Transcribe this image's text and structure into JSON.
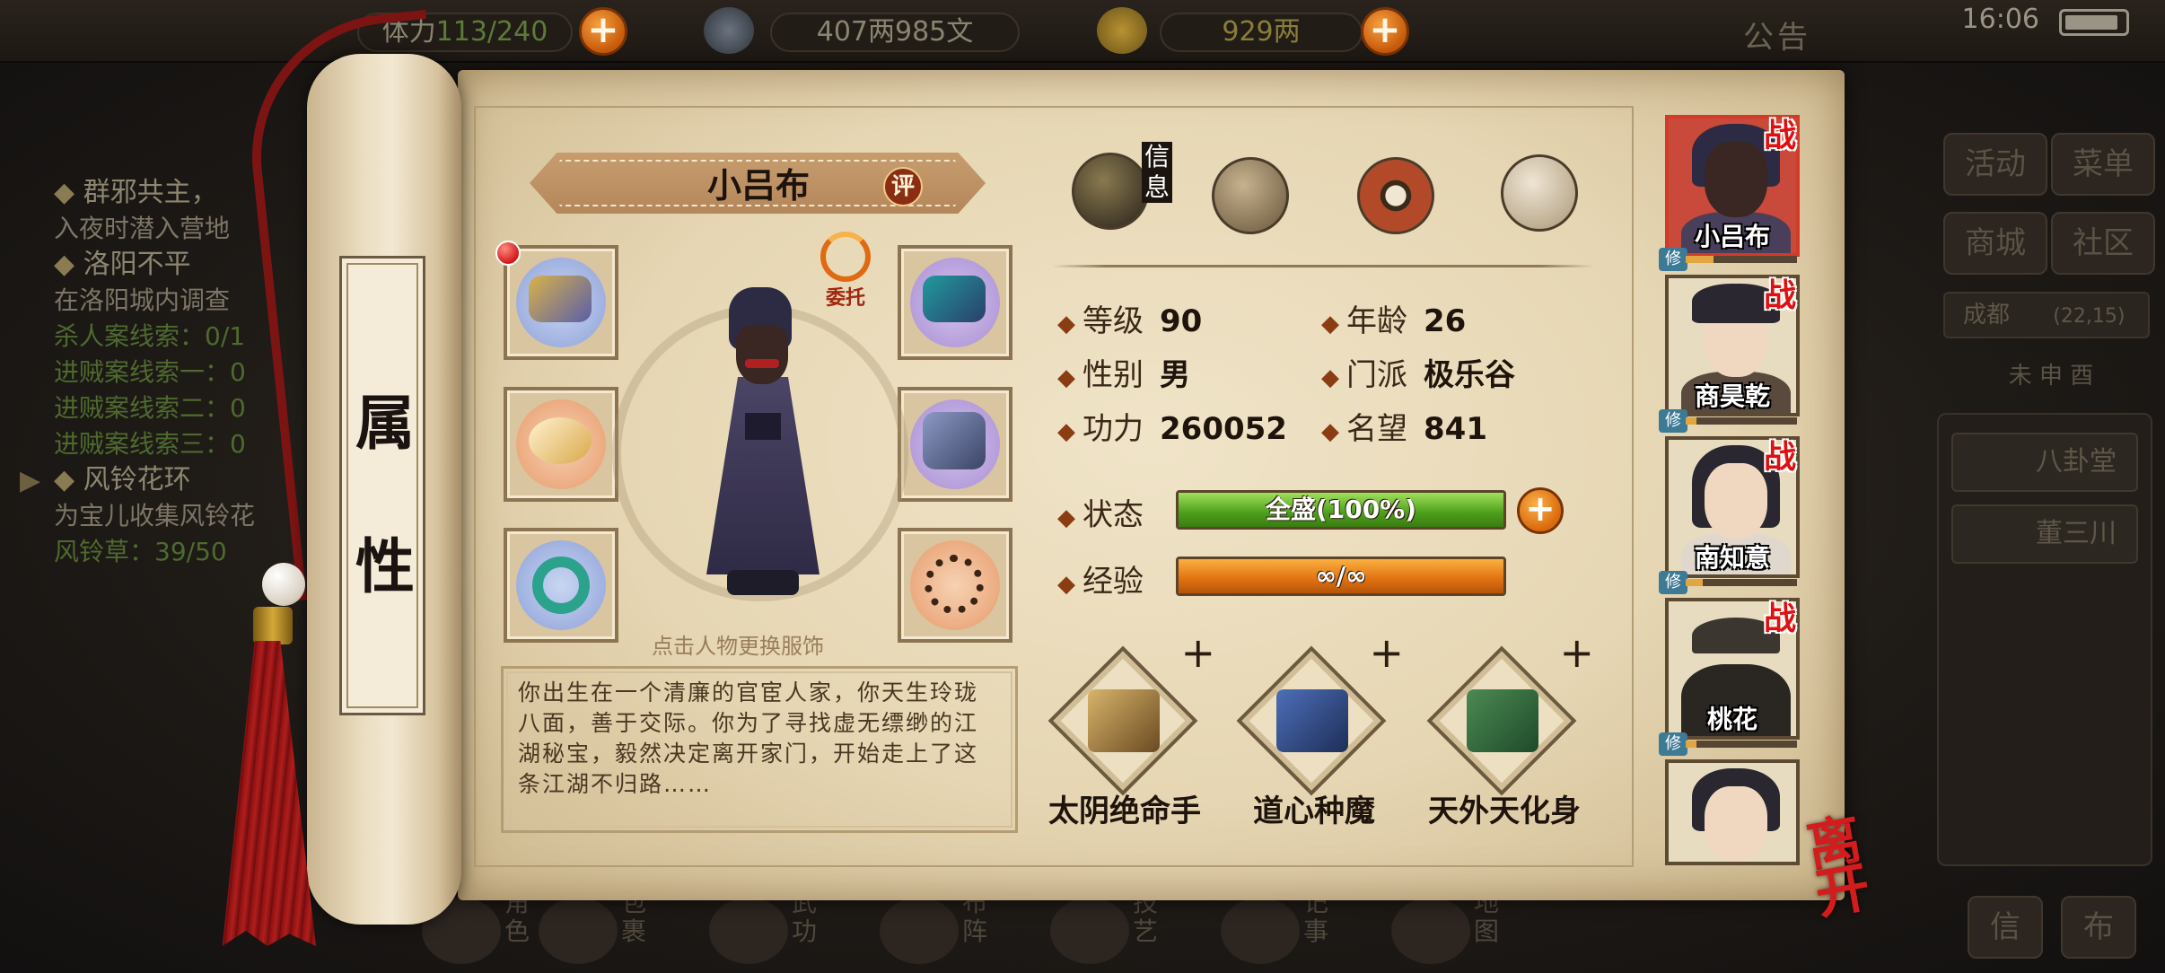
{
  "topbar": {
    "stamina": "113/240",
    "stamina_label": "体力",
    "coins": "407两985文",
    "ingots": "929两",
    "notice": "公告",
    "time": "16:06"
  },
  "quests": [
    {
      "title": "群邪共主，",
      "lines": [
        {
          "text": "入夜时潜入营地",
          "green": false
        }
      ]
    },
    {
      "title": "洛阳不平",
      "lines": [
        {
          "text": "在洛阳城内调查",
          "green": false
        },
        {
          "text": "杀人案线索：0/1",
          "green": true
        },
        {
          "text": "进贼案线索一：0",
          "green": true
        },
        {
          "text": "进贼案线索二：0",
          "green": true
        },
        {
          "text": "进贼案线索三：0",
          "green": true
        }
      ]
    },
    {
      "title": "风铃花环",
      "lines": [
        {
          "text": "为宝儿收集风铃花",
          "green": false
        },
        {
          "text": "风铃草：39/50",
          "green": true
        }
      ]
    }
  ],
  "right_menu": {
    "buttons": [
      "活动",
      "菜单",
      "商城",
      "社区"
    ],
    "city": "成都",
    "coords": "(22,15)",
    "time_marks": "未 申 酉",
    "npcs": [
      "八卦堂",
      "董三川"
    ],
    "bottom_buttons": [
      "信",
      "布"
    ]
  },
  "bottom_nav": [
    "角色",
    "包裹",
    "武功",
    "布阵",
    "技艺",
    "记事",
    "地图"
  ],
  "scroll": {
    "label_chars": [
      "属",
      "性"
    ]
  },
  "character": {
    "name": "小吕布",
    "eval_label": "评",
    "delegate_label": "委托",
    "change_outfit_hint": "点击人物更换服饰",
    "bio": "你出生在一个清廉的官宦人家，你天生玲珑八面，善于交际。你为了寻找虚无缥缈的江湖秘宝，毅然决定离开家门，开始走上了这条江湖不归路……"
  },
  "tabs": {
    "info_label": "信息"
  },
  "stats": {
    "level_label": "等级",
    "level": "90",
    "age_label": "年龄",
    "age": "26",
    "gender_label": "性别",
    "gender": "男",
    "sect_label": "门派",
    "sect": "极乐谷",
    "power_label": "功力",
    "power": "260052",
    "fame_label": "名望",
    "fame": "841",
    "status_label": "状态",
    "status_text": "全盛(100%)",
    "status_fraction": 1.0,
    "exp_label": "经验",
    "exp_text": "∞/∞",
    "exp_fraction": 1.0
  },
  "skills": [
    {
      "name": "太阴绝命手",
      "plus": "+"
    },
    {
      "name": "道心种魔",
      "plus": "+"
    },
    {
      "name": "天外天化身",
      "plus": "+"
    }
  ],
  "companions": [
    {
      "name": "小吕布",
      "battle_mark": "战",
      "train_mark": "修",
      "train_fraction": 0.25
    },
    {
      "name": "商昊乾",
      "battle_mark": "战",
      "train_mark": "修",
      "train_fraction": 0.1
    },
    {
      "name": "南知意",
      "battle_mark": "战",
      "train_mark": "修",
      "train_fraction": 0.15
    },
    {
      "name": "桃花",
      "battle_mark": "战",
      "train_mark": "修",
      "train_fraction": 0.1
    },
    {
      "name": "",
      "battle_mark": "",
      "train_mark": "",
      "train_fraction": 0
    }
  ],
  "leave_label": "离开",
  "colors": {
    "accent_red": "#d41c1c",
    "status_green": "#4c9e1a",
    "exp_orange": "#e07010",
    "paper": "#e6d6b3"
  },
  "icons": {
    "slots": [
      "gauntlet-icon",
      "flower-ornament-icon",
      "jade-ring-icon",
      "helmet-icon",
      "armor-icon",
      "prayer-beads-icon"
    ],
    "tabs": [
      "info-portrait-icon",
      "scroll-map-icon",
      "bagua-icon",
      "meridian-body-icon"
    ]
  }
}
